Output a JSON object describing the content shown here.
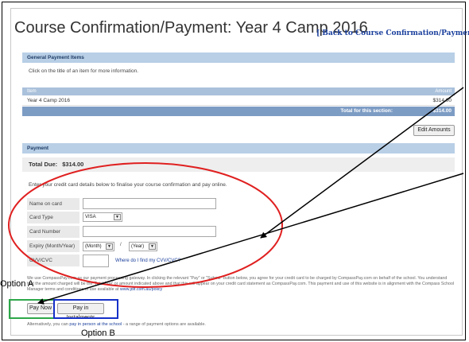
{
  "page": {
    "title": "Course Confirmation/Payment: Year 4 Camp 2016",
    "back_link": "[ Back to Course Confirmation/Payments ]"
  },
  "general": {
    "header": "General Payment Items",
    "hint": "Click on the title of an item for more information.",
    "col_item": "Item",
    "col_amount": "Amount",
    "rows": [
      {
        "item": "Year 4 Camp 2016",
        "amount": "$314.00"
      }
    ],
    "total_label": "Total for this section:",
    "total_value": "$314.00",
    "edit_button": "Edit Amounts"
  },
  "payment": {
    "header": "Payment",
    "total_due_label": "Total Due:",
    "total_due_value": "$314.00",
    "instructions": "Enter your credit card details below to finalise your course confirmation and pay online.",
    "fields": {
      "name_label": "Name on card",
      "name_value": "",
      "type_label": "Card Type",
      "type_value": "VISA",
      "number_label": "Card Number",
      "number_value": "",
      "expiry_label": "Expiry (Month/Year)",
      "expiry_month": "(Month)",
      "expiry_sep": "/",
      "expiry_year": "(Year)",
      "cvv_label": "CVV/CVC",
      "cvv_value": "",
      "cvv_help": "Where do I find my CVV/CVC?"
    },
    "disclaimer": "We use CompassPay.com as our payment processing gateway. In clicking the relevant \"Pay\" or \"Submit\" button below, you agree for your credit card to be charged by CompassPay.com on behalf of the school. You understand that the amount charged will be the 'Total Due' or amount indicated above and that this will appear on your credit card statement as CompassPay.com. This payment and use of this website is in alignment with the Compass School Manager terms and conditions of use available at",
    "disclaimer_link": "www.jdlf.com.au/policy",
    "pay_now": "Pay Now",
    "pay_installments": "Pay in Instalments",
    "alt_prefix": "Alternatively, you can",
    "alt_link": "pay in person at the school",
    "alt_suffix": "- a range of payment options are available."
  },
  "annotations": {
    "option_a": "Option A",
    "option_b": "Option B",
    "colors": {
      "ellipse": "#e02020",
      "option_a_box": "#2ea84a",
      "option_b_box": "#1530c8",
      "arrow": "#000000"
    }
  }
}
